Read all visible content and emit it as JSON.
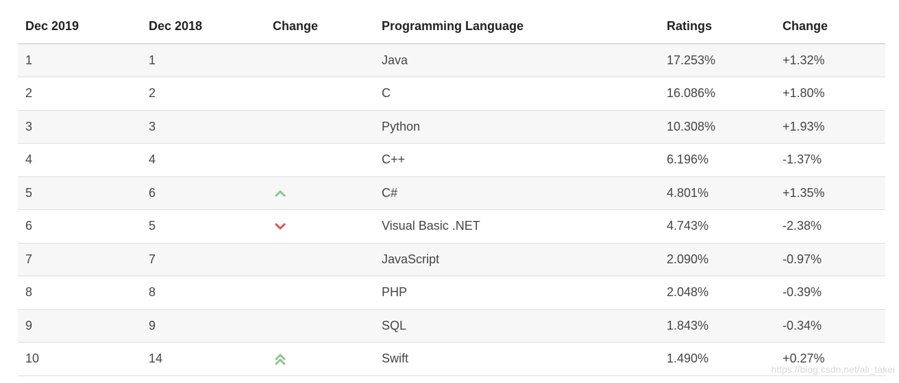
{
  "table": {
    "headers": [
      "Dec 2019",
      "Dec 2018",
      "Change",
      "Programming Language",
      "Ratings",
      "Change"
    ],
    "rows": [
      {
        "dec2019": "1",
        "dec2018": "1",
        "trend": "none",
        "language": "Java",
        "rating": "17.253%",
        "change": "+1.32%"
      },
      {
        "dec2019": "2",
        "dec2018": "2",
        "trend": "none",
        "language": "C",
        "rating": "16.086%",
        "change": "+1.80%"
      },
      {
        "dec2019": "3",
        "dec2018": "3",
        "trend": "none",
        "language": "Python",
        "rating": "10.308%",
        "change": "+1.93%"
      },
      {
        "dec2019": "4",
        "dec2018": "4",
        "trend": "none",
        "language": "C++",
        "rating": "6.196%",
        "change": "-1.37%"
      },
      {
        "dec2019": "5",
        "dec2018": "6",
        "trend": "up",
        "language": "C#",
        "rating": "4.801%",
        "change": "+1.35%"
      },
      {
        "dec2019": "6",
        "dec2018": "5",
        "trend": "down",
        "language": "Visual Basic .NET",
        "rating": "4.743%",
        "change": "-2.38%"
      },
      {
        "dec2019": "7",
        "dec2018": "7",
        "trend": "none",
        "language": "JavaScript",
        "rating": "2.090%",
        "change": "-0.97%"
      },
      {
        "dec2019": "8",
        "dec2018": "8",
        "trend": "none",
        "language": "PHP",
        "rating": "2.048%",
        "change": "-0.39%"
      },
      {
        "dec2019": "9",
        "dec2018": "9",
        "trend": "none",
        "language": "SQL",
        "rating": "1.843%",
        "change": "-0.34%"
      },
      {
        "dec2019": "10",
        "dec2018": "14",
        "trend": "double-up",
        "language": "Swift",
        "rating": "1.490%",
        "change": "+0.27%"
      }
    ]
  },
  "icons": {
    "up": "chevron-up-icon",
    "down": "chevron-down-icon",
    "double-up": "double-chevron-up-icon"
  },
  "colors": {
    "up": "#8cc68c",
    "down": "#d9534f",
    "stripe": "#f7f7f7",
    "border": "#dddddd"
  },
  "watermark": "https://blog.csdn.net/ali_takei"
}
